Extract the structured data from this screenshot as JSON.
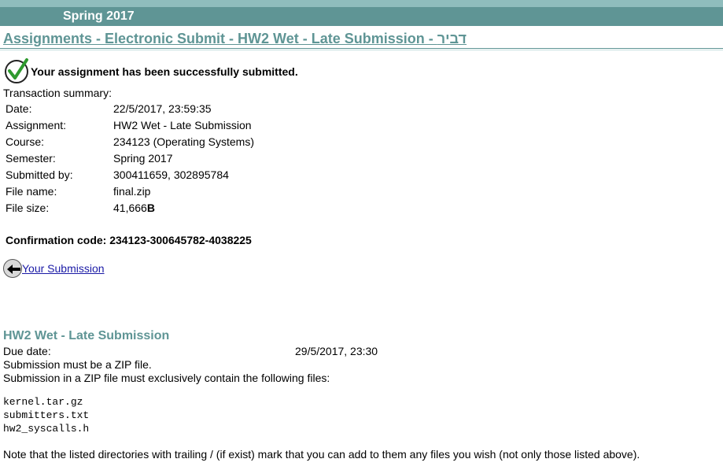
{
  "header": {
    "semester": "Spring 2017",
    "page_title": "Assignments - Electronic Submit - HW2 Wet - Late Submission - דביר"
  },
  "success": {
    "message": "Your assignment has been successfully submitted.",
    "icon": "checkmark-icon"
  },
  "summary": {
    "label": "Transaction summary:",
    "rows": [
      {
        "key": "Date:",
        "value": "22/5/2017, 23:59:35"
      },
      {
        "key": "Assignment:",
        "value": "HW2 Wet - Late Submission"
      },
      {
        "key": "Course:",
        "value": "234123 (Operating Systems)"
      },
      {
        "key": "Semester:",
        "value": "Spring 2017"
      },
      {
        "key": "Submitted by:",
        "value": "300411659, 302895784"
      },
      {
        "key": "File name:",
        "value": "final.zip"
      }
    ],
    "file_size_key": "File size:",
    "file_size_value": "41,666",
    "file_size_unit": "B",
    "confirmation": "Confirmation code: 234123-300645782-4038225"
  },
  "back_link": {
    "label": " Your Submission",
    "icon": "back-arrow-icon"
  },
  "assignment": {
    "title": "HW2 Wet - Late Submission",
    "due_label": "Due date:",
    "due_value": "29/5/2017, 23:30",
    "requirement_zip": "Submission must be a ZIP file.",
    "requirement_files": "Submission in a ZIP file must exclusively contain the following files:",
    "files": [
      "kernel.tar.gz",
      "submitters.txt",
      "hw2_syscalls.h"
    ],
    "note": "Note that the listed directories with trailing / (if exist) mark that you can add to them any files you wish (not only those listed above)."
  },
  "colors": {
    "header_bar": "#5f9595",
    "top_strip": "#8fbdbd",
    "title_text": "#5f9595",
    "link": "#1a1aa6"
  }
}
